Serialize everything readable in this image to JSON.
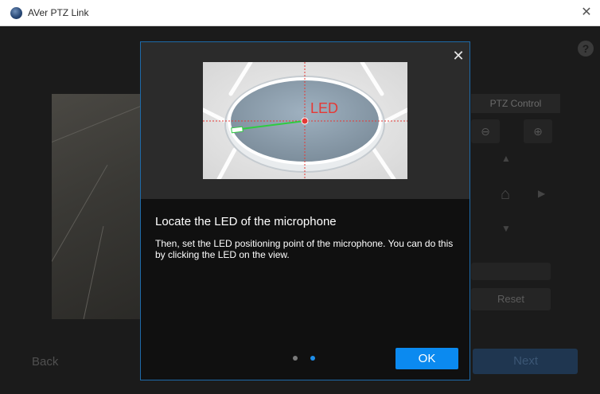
{
  "window": {
    "title": "AVer PTZ Link",
    "close_glyph": "✕"
  },
  "background": {
    "help_glyph": "?",
    "ptz": {
      "label": "PTZ Control",
      "zoom_out_glyph": "⊖",
      "zoom_in_glyph": "⊕",
      "home_glyph": "⌂",
      "reset_label": "Reset"
    },
    "back_label": "Back",
    "next_label": "Next"
  },
  "dialog": {
    "close_glyph": "✕",
    "illustration_label": "LED",
    "heading": "Locate the LED of the microphone",
    "body": "Then, set the LED positioning point of the microphone. You can do this by clicking the LED on the view.",
    "pagination": {
      "current": 2,
      "total": 2
    },
    "ok_label": "OK"
  },
  "colors": {
    "accent": "#0b8af0",
    "dialog_border": "#1e6aa8",
    "led_label": "#e53935",
    "indicator_line": "#2ecc40"
  },
  "icons": [
    "app-logo-icon",
    "close-icon",
    "help-icon",
    "zoom-out-icon",
    "zoom-in-icon",
    "home-icon",
    "arrow-up-icon",
    "arrow-down-icon",
    "arrow-right-icon"
  ]
}
